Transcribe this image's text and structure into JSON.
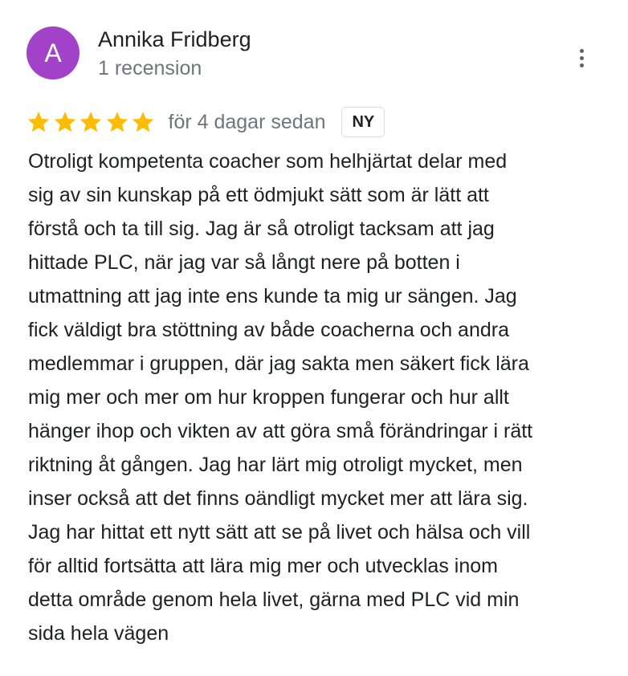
{
  "author": {
    "initial": "A",
    "name": "Annika Fridberg",
    "meta": "1 recension",
    "avatar_color": "#a142c9"
  },
  "rating": {
    "stars": 5,
    "max_stars": 5,
    "star_color": "#fbbc04",
    "date": "för 4 dagar sedan",
    "badge": "NY"
  },
  "menu": {
    "icon": "more-vert-icon"
  },
  "review": {
    "lines": [
      "Otroligt kompetenta coacher som helhjärtat delar med",
      "sig av sin kunskap på ett ödmjukt sätt som är lätt att",
      "förstå och ta till sig. Jag är så otroligt tacksam att jag",
      "hittade PLC, när jag var så långt nere på botten i",
      "utmattning att jag inte ens kunde ta mig ur sängen. Jag",
      "fick väldigt bra stöttning av både coacherna och andra",
      "medlemmar i gruppen, där jag sakta men säkert fick lära",
      "mig mer och mer om hur kroppen fungerar och hur allt",
      "hänger ihop och vikten av att göra små förändringar i rätt",
      "riktning åt gången. Jag har lärt mig otroligt mycket, men",
      "inser också att det finns oändligt mycket mer att lära sig.",
      "Jag har hittat ett nytt sätt att se på livet och hälsa och vill",
      "för alltid fortsätta att lära mig mer och utvecklas inom",
      "detta område genom hela livet, gärna med PLC vid min",
      "sida hela vägen"
    ],
    "emoji": "❤️"
  }
}
